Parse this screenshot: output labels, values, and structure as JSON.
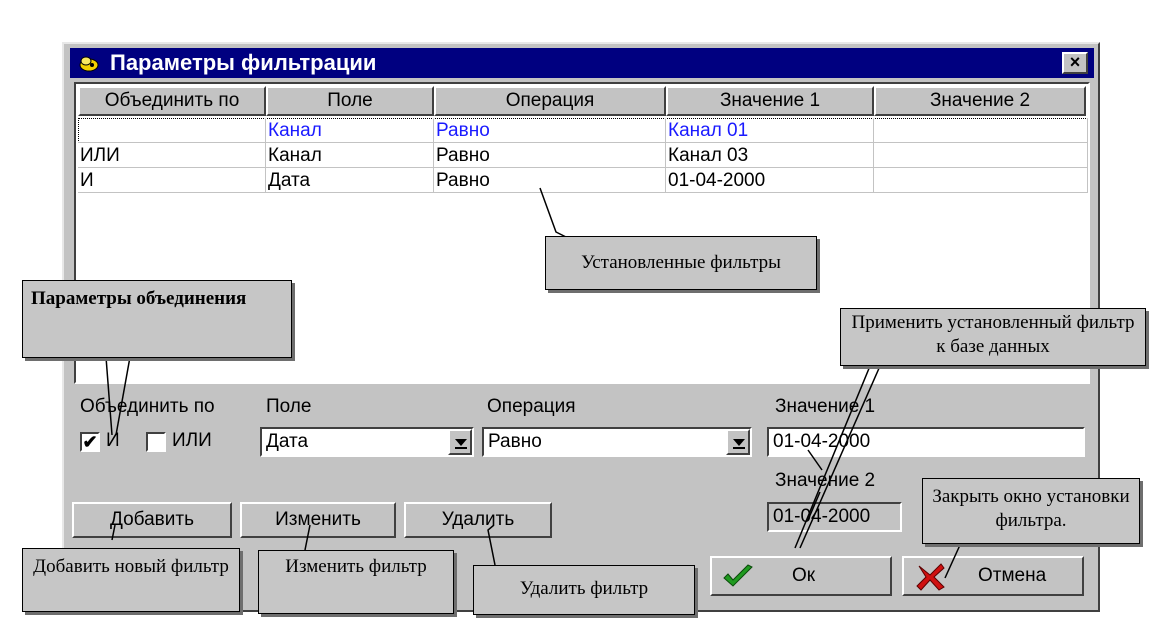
{
  "window": {
    "title": "Параметры фильтрации",
    "close_label": "×"
  },
  "grid": {
    "headers": [
      "Объединить по",
      "Поле",
      "Операция",
      "Значение 1",
      "Значение 2"
    ],
    "rows": [
      {
        "join": "",
        "field": "Канал",
        "operation": "Равно",
        "value1": "Канал 01",
        "value2": ""
      },
      {
        "join": "ИЛИ",
        "field": "Канал",
        "operation": "Равно",
        "value1": "Канал 03",
        "value2": ""
      },
      {
        "join": "И",
        "field": "Дата",
        "operation": "Равно",
        "value1": "01-04-2000",
        "value2": ""
      }
    ]
  },
  "form": {
    "join_label": "Объединить по",
    "and_label": "И",
    "or_label": "ИЛИ",
    "and_checked": true,
    "or_checked": false,
    "field_label": "Поле",
    "field_value": "Дата",
    "operation_label": "Операция",
    "operation_value": "Равно",
    "value1_label": "Значение 1",
    "value1_value": "01-04-2000",
    "value2_label": "Значение 2",
    "value2_value": "01-04-2000"
  },
  "buttons": {
    "add": "Добавить",
    "edit": "Изменить",
    "delete": "Удалить",
    "ok": "Ок",
    "cancel": "Отмена"
  },
  "callouts": {
    "filters": "Установленные фильтры",
    "join_params": "Параметры объединения",
    "apply": "Применить установленный фильтр к базе данных",
    "close": "Закрыть окно установки фильтра.",
    "add_new": "Добавить новый фильтр",
    "edit_filter": "Изменить фильтр",
    "delete_filter": "Удалить фильтр"
  },
  "colors": {
    "titlebar": "#000080",
    "dialog_bg": "#c3c3c3",
    "selected_row_text": "#1a1aff",
    "ok_icon": "#1f9a1f",
    "cancel_icon": "#d01010"
  }
}
